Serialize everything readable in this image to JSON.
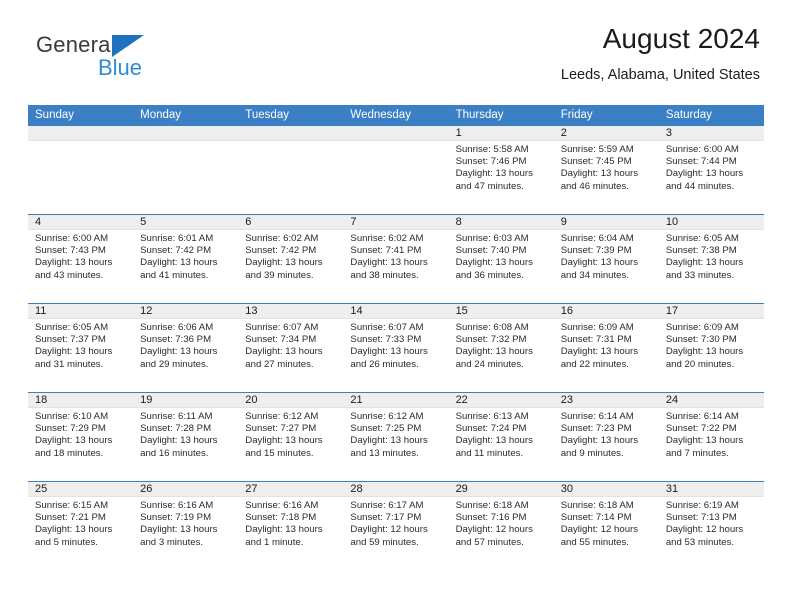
{
  "brand": {
    "name_top": "General",
    "name_bottom": "Blue"
  },
  "header": {
    "title": "August 2024",
    "subtitle": "Leeds, Alabama, United States"
  },
  "colors": {
    "header_blue": "#3b7fc4",
    "brand_blue": "#2e8bd6",
    "daynum_band": "#eeeeee"
  },
  "weekday_headers": [
    "Sunday",
    "Monday",
    "Tuesday",
    "Wednesday",
    "Thursday",
    "Friday",
    "Saturday"
  ],
  "weeks": [
    [
      {
        "day": "",
        "sunrise": "",
        "sunset": "",
        "daylight_line1": "",
        "daylight_line2": ""
      },
      {
        "day": "",
        "sunrise": "",
        "sunset": "",
        "daylight_line1": "",
        "daylight_line2": ""
      },
      {
        "day": "",
        "sunrise": "",
        "sunset": "",
        "daylight_line1": "",
        "daylight_line2": ""
      },
      {
        "day": "",
        "sunrise": "",
        "sunset": "",
        "daylight_line1": "",
        "daylight_line2": ""
      },
      {
        "day": "1",
        "sunrise": "Sunrise: 5:58 AM",
        "sunset": "Sunset: 7:46 PM",
        "daylight_line1": "Daylight: 13 hours",
        "daylight_line2": "and 47 minutes."
      },
      {
        "day": "2",
        "sunrise": "Sunrise: 5:59 AM",
        "sunset": "Sunset: 7:45 PM",
        "daylight_line1": "Daylight: 13 hours",
        "daylight_line2": "and 46 minutes."
      },
      {
        "day": "3",
        "sunrise": "Sunrise: 6:00 AM",
        "sunset": "Sunset: 7:44 PM",
        "daylight_line1": "Daylight: 13 hours",
        "daylight_line2": "and 44 minutes."
      }
    ],
    [
      {
        "day": "4",
        "sunrise": "Sunrise: 6:00 AM",
        "sunset": "Sunset: 7:43 PM",
        "daylight_line1": "Daylight: 13 hours",
        "daylight_line2": "and 43 minutes."
      },
      {
        "day": "5",
        "sunrise": "Sunrise: 6:01 AM",
        "sunset": "Sunset: 7:42 PM",
        "daylight_line1": "Daylight: 13 hours",
        "daylight_line2": "and 41 minutes."
      },
      {
        "day": "6",
        "sunrise": "Sunrise: 6:02 AM",
        "sunset": "Sunset: 7:42 PM",
        "daylight_line1": "Daylight: 13 hours",
        "daylight_line2": "and 39 minutes."
      },
      {
        "day": "7",
        "sunrise": "Sunrise: 6:02 AM",
        "sunset": "Sunset: 7:41 PM",
        "daylight_line1": "Daylight: 13 hours",
        "daylight_line2": "and 38 minutes."
      },
      {
        "day": "8",
        "sunrise": "Sunrise: 6:03 AM",
        "sunset": "Sunset: 7:40 PM",
        "daylight_line1": "Daylight: 13 hours",
        "daylight_line2": "and 36 minutes."
      },
      {
        "day": "9",
        "sunrise": "Sunrise: 6:04 AM",
        "sunset": "Sunset: 7:39 PM",
        "daylight_line1": "Daylight: 13 hours",
        "daylight_line2": "and 34 minutes."
      },
      {
        "day": "10",
        "sunrise": "Sunrise: 6:05 AM",
        "sunset": "Sunset: 7:38 PM",
        "daylight_line1": "Daylight: 13 hours",
        "daylight_line2": "and 33 minutes."
      }
    ],
    [
      {
        "day": "11",
        "sunrise": "Sunrise: 6:05 AM",
        "sunset": "Sunset: 7:37 PM",
        "daylight_line1": "Daylight: 13 hours",
        "daylight_line2": "and 31 minutes."
      },
      {
        "day": "12",
        "sunrise": "Sunrise: 6:06 AM",
        "sunset": "Sunset: 7:36 PM",
        "daylight_line1": "Daylight: 13 hours",
        "daylight_line2": "and 29 minutes."
      },
      {
        "day": "13",
        "sunrise": "Sunrise: 6:07 AM",
        "sunset": "Sunset: 7:34 PM",
        "daylight_line1": "Daylight: 13 hours",
        "daylight_line2": "and 27 minutes."
      },
      {
        "day": "14",
        "sunrise": "Sunrise: 6:07 AM",
        "sunset": "Sunset: 7:33 PM",
        "daylight_line1": "Daylight: 13 hours",
        "daylight_line2": "and 26 minutes."
      },
      {
        "day": "15",
        "sunrise": "Sunrise: 6:08 AM",
        "sunset": "Sunset: 7:32 PM",
        "daylight_line1": "Daylight: 13 hours",
        "daylight_line2": "and 24 minutes."
      },
      {
        "day": "16",
        "sunrise": "Sunrise: 6:09 AM",
        "sunset": "Sunset: 7:31 PM",
        "daylight_line1": "Daylight: 13 hours",
        "daylight_line2": "and 22 minutes."
      },
      {
        "day": "17",
        "sunrise": "Sunrise: 6:09 AM",
        "sunset": "Sunset: 7:30 PM",
        "daylight_line1": "Daylight: 13 hours",
        "daylight_line2": "and 20 minutes."
      }
    ],
    [
      {
        "day": "18",
        "sunrise": "Sunrise: 6:10 AM",
        "sunset": "Sunset: 7:29 PM",
        "daylight_line1": "Daylight: 13 hours",
        "daylight_line2": "and 18 minutes."
      },
      {
        "day": "19",
        "sunrise": "Sunrise: 6:11 AM",
        "sunset": "Sunset: 7:28 PM",
        "daylight_line1": "Daylight: 13 hours",
        "daylight_line2": "and 16 minutes."
      },
      {
        "day": "20",
        "sunrise": "Sunrise: 6:12 AM",
        "sunset": "Sunset: 7:27 PM",
        "daylight_line1": "Daylight: 13 hours",
        "daylight_line2": "and 15 minutes."
      },
      {
        "day": "21",
        "sunrise": "Sunrise: 6:12 AM",
        "sunset": "Sunset: 7:25 PM",
        "daylight_line1": "Daylight: 13 hours",
        "daylight_line2": "and 13 minutes."
      },
      {
        "day": "22",
        "sunrise": "Sunrise: 6:13 AM",
        "sunset": "Sunset: 7:24 PM",
        "daylight_line1": "Daylight: 13 hours",
        "daylight_line2": "and 11 minutes."
      },
      {
        "day": "23",
        "sunrise": "Sunrise: 6:14 AM",
        "sunset": "Sunset: 7:23 PM",
        "daylight_line1": "Daylight: 13 hours",
        "daylight_line2": "and 9 minutes."
      },
      {
        "day": "24",
        "sunrise": "Sunrise: 6:14 AM",
        "sunset": "Sunset: 7:22 PM",
        "daylight_line1": "Daylight: 13 hours",
        "daylight_line2": "and 7 minutes."
      }
    ],
    [
      {
        "day": "25",
        "sunrise": "Sunrise: 6:15 AM",
        "sunset": "Sunset: 7:21 PM",
        "daylight_line1": "Daylight: 13 hours",
        "daylight_line2": "and 5 minutes."
      },
      {
        "day": "26",
        "sunrise": "Sunrise: 6:16 AM",
        "sunset": "Sunset: 7:19 PM",
        "daylight_line1": "Daylight: 13 hours",
        "daylight_line2": "and 3 minutes."
      },
      {
        "day": "27",
        "sunrise": "Sunrise: 6:16 AM",
        "sunset": "Sunset: 7:18 PM",
        "daylight_line1": "Daylight: 13 hours",
        "daylight_line2": "and 1 minute."
      },
      {
        "day": "28",
        "sunrise": "Sunrise: 6:17 AM",
        "sunset": "Sunset: 7:17 PM",
        "daylight_line1": "Daylight: 12 hours",
        "daylight_line2": "and 59 minutes."
      },
      {
        "day": "29",
        "sunrise": "Sunrise: 6:18 AM",
        "sunset": "Sunset: 7:16 PM",
        "daylight_line1": "Daylight: 12 hours",
        "daylight_line2": "and 57 minutes."
      },
      {
        "day": "30",
        "sunrise": "Sunrise: 6:18 AM",
        "sunset": "Sunset: 7:14 PM",
        "daylight_line1": "Daylight: 12 hours",
        "daylight_line2": "and 55 minutes."
      },
      {
        "day": "31",
        "sunrise": "Sunrise: 6:19 AM",
        "sunset": "Sunset: 7:13 PM",
        "daylight_line1": "Daylight: 12 hours",
        "daylight_line2": "and 53 minutes."
      }
    ]
  ]
}
